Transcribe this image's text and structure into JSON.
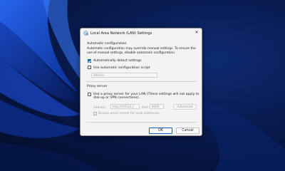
{
  "dialog": {
    "title": "Local Area Network (LAN) Settings",
    "close_glyph": "✕",
    "icon": "network-globe-icon"
  },
  "auto_config": {
    "heading": "Automatic configuration",
    "description_line1": "Automatic configuration may override manual settings.  To ensure the",
    "description_line2": "use of manual settings, disable automatic configuration.",
    "detect_label": "Automatically detect settings",
    "detect_checked": true,
    "script_label": "Use automatic configuration script",
    "script_checked": false,
    "address_placeholder": "Address"
  },
  "proxy": {
    "heading": "Proxy server",
    "use_proxy_line1": "Use a proxy server for your LAN (These settings will not apply to",
    "use_proxy_line2": "dial-up or VPN connections).",
    "use_proxy_checked": false,
    "address_label": "Address:",
    "address_value": "http://103.22.2",
    "port_label": "Port:",
    "port_value": "8080",
    "advanced_label": "Advanced",
    "bypass_label": "Bypass proxy server for local addresses",
    "bypass_checked": false
  },
  "buttons": {
    "ok_label": "OK",
    "cancel_label": "Cancel"
  },
  "colors": {
    "accent": "#0a5fc0",
    "wallpaper": "#0b1e52"
  }
}
